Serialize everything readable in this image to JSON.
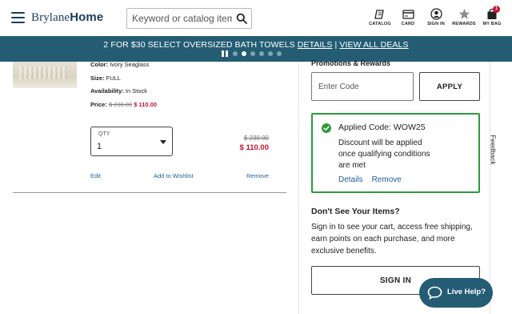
{
  "header": {
    "logo_prefix": "Brylane",
    "logo_suffix": "Home",
    "search_placeholder": "Keyword or catalog item#",
    "nav": [
      {
        "label": "CATALOG",
        "icon": "catalog-icon"
      },
      {
        "label": "CARD",
        "icon": "card-icon"
      },
      {
        "label": "SIGN IN",
        "icon": "account-icon"
      },
      {
        "label": "REWARDS",
        "icon": "star-icon"
      },
      {
        "label": "MY BAG",
        "icon": "bag-icon"
      }
    ],
    "bag_count": "1"
  },
  "promo_banner": {
    "text": "2 FOR $30 SELECT OVERSIZED BATH TOWELS",
    "details_link": "DETAILS",
    "separator": "|",
    "view_all_link": "VIEW ALL DEALS",
    "slide_count": 6,
    "active_slide": 1
  },
  "product": {
    "color_label": "Color:",
    "color_value": "Ivory Seaglass",
    "size_label": "Size:",
    "size_value": "FULL",
    "availability_label": "Availability:",
    "availability_value": "In Stock",
    "price_label": "Price:",
    "price_original": "$ 230.00",
    "price_sale": "$ 110.00",
    "qty_label": "QTY",
    "qty_value": "1",
    "total_original": "$ 230.00",
    "total_sale": "$ 110.00",
    "edit_link": "Edit",
    "wishlist_link": "Add to Wishlist",
    "remove_link": "Remove"
  },
  "promotions": {
    "heading": "Promotions & Rewards",
    "code_placeholder": "Enter Code",
    "apply_label": "APPLY",
    "applied_title": "Applied Code: WOW25",
    "applied_message": "Discount will be applied once qualifying conditions are met",
    "details_link": "Details",
    "remove_link": "Remove"
  },
  "signin_prompt": {
    "heading": "Don't See Your Items?",
    "message": "Sign in to see your cart, access free shipping, earn points on each purchase, and more exclusive benefits.",
    "button_label": "SIGN IN"
  },
  "feedback_tab": "Feedback",
  "live_help": "Live Help?",
  "colors": {
    "brand_teal": "#245d73",
    "sale_red": "#c8102e",
    "success_green": "#2e9a3d",
    "link_blue": "#245d9a"
  }
}
